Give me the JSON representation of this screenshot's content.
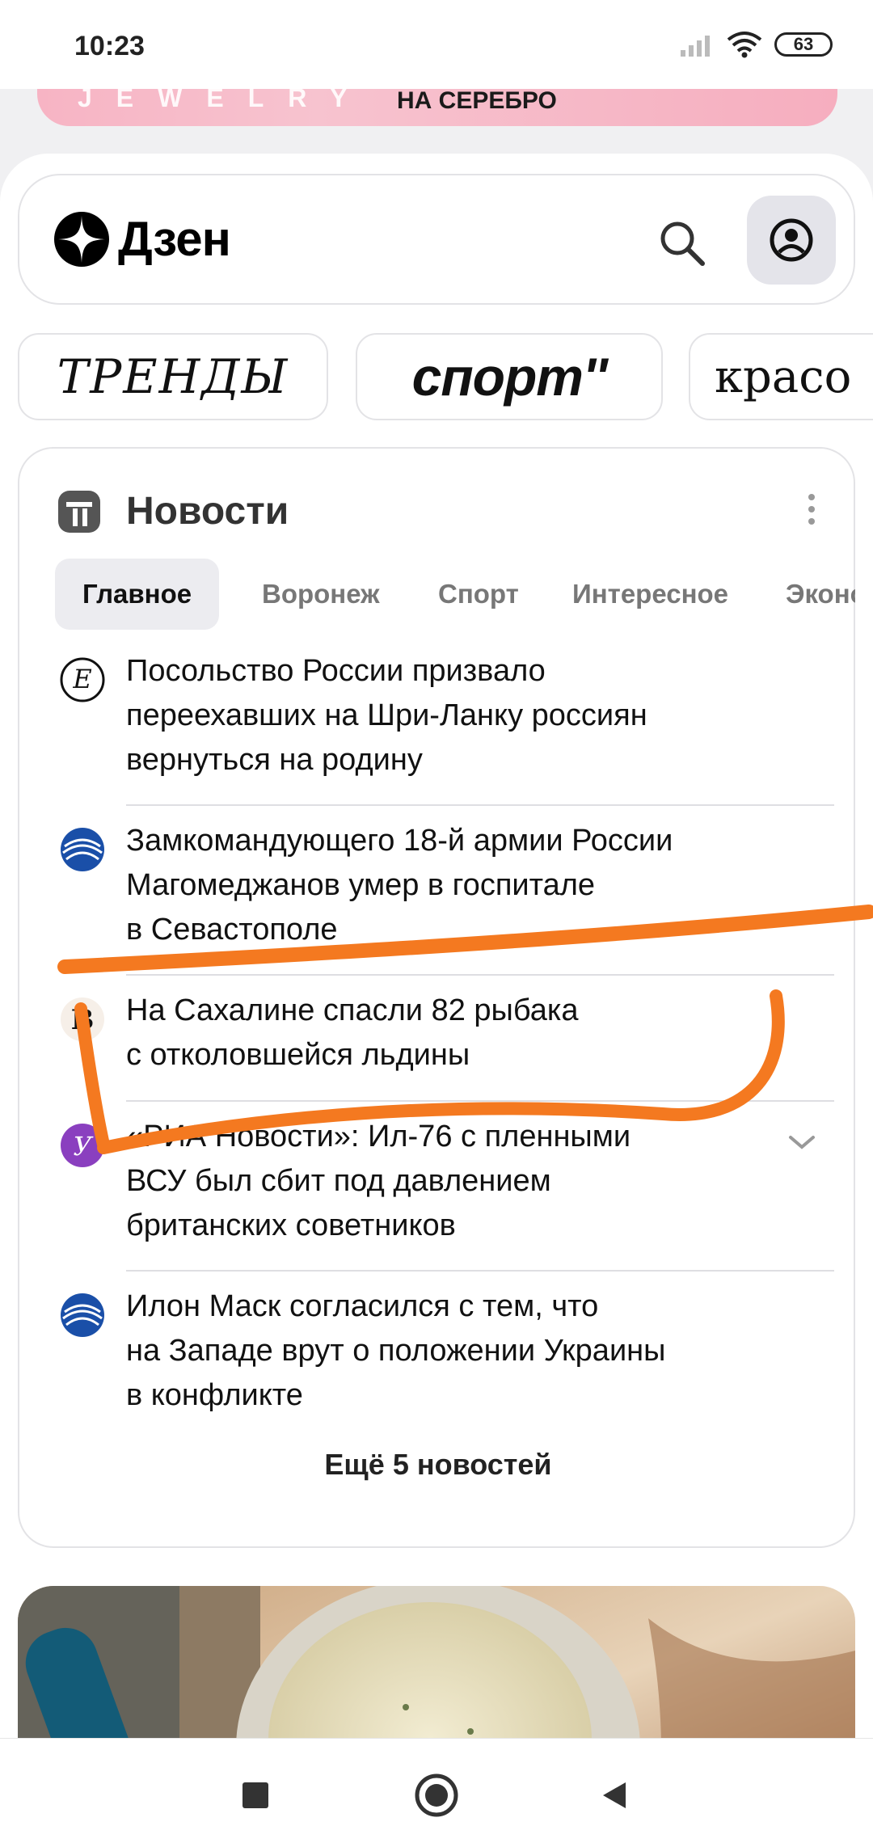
{
  "status_bar": {
    "time": "10:23",
    "battery": "63"
  },
  "ad_banner": {
    "brand": "JEWELRY",
    "text": "НА СЕРЕБРО"
  },
  "header": {
    "logo_text": "Дзен"
  },
  "chips": [
    {
      "label": "ТРЕНДЫ"
    },
    {
      "label": "спорт''"
    },
    {
      "label": "красо"
    }
  ],
  "news": {
    "title": "Новости",
    "tabs": [
      "Главное",
      "Воронеж",
      "Спорт",
      "Интересное",
      "Эконо"
    ],
    "active_tab": "Главное",
    "items": [
      {
        "lines": [
          "Посольство России призвало",
          "переехавших на Шри-Ланку россиян",
          "вернуться на родину"
        ],
        "source_icon": "source-logo-e-icon"
      },
      {
        "lines": [
          "Замкомандующего 18-й армии России",
          "Магомеджанов умер в госпитале",
          "в Севастополе"
        ],
        "source_icon": "source-logo-globe-icon"
      },
      {
        "lines": [
          "На Сахалине спасли 82 рыбака",
          "с отколовшейся льдины"
        ],
        "source_icon": "source-logo-b-icon"
      },
      {
        "lines": [
          "«РИА Новости»: Ил-76 с пленными",
          "ВСУ был сбит под давлением",
          "британских советников"
        ],
        "source_icon": "source-logo-y-icon"
      },
      {
        "lines": [
          "Илон Маск согласился с тем, что",
          "на Западе врут о положении Украины",
          "в конфликте"
        ],
        "source_icon": "source-logo-globe-icon"
      }
    ],
    "more_label": "Ещё 5 новостей"
  },
  "colors": {
    "annotation": "#f47920",
    "accent_blue": "#1a4fa8",
    "purple": "#8a3fbf"
  }
}
